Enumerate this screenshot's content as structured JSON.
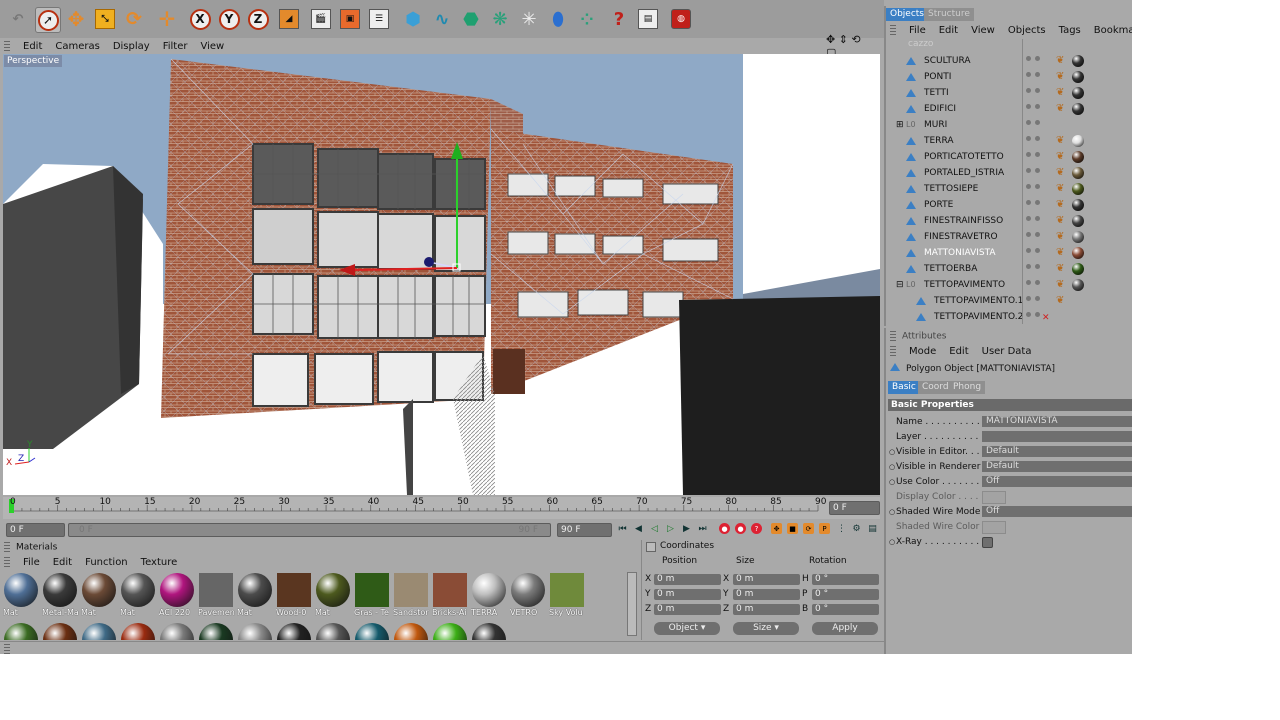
{
  "viewport": {
    "menu": [
      "Edit",
      "Cameras",
      "Display",
      "Filter",
      "View"
    ],
    "camera_label": "Perspective",
    "axis_labels": {
      "x": "X",
      "y": "Y",
      "z": "Z"
    }
  },
  "timeline": {
    "ticks": [
      "0",
      "5",
      "10",
      "15",
      "20",
      "25",
      "30",
      "35",
      "40",
      "45",
      "50",
      "55",
      "60",
      "65",
      "70",
      "75",
      "80",
      "85",
      "90"
    ],
    "current_frame": "0 F",
    "start_field": "0 F",
    "range_start": "0 F",
    "range_end": "90 F",
    "end_field": "90 F"
  },
  "materials": {
    "title": "Materials",
    "menu": [
      "File",
      "Edit",
      "Function",
      "Texture"
    ],
    "items": [
      {
        "label": "Mat",
        "color": "#4f6f96"
      },
      {
        "label": "Metal-Ma",
        "color": "#3a3a3a"
      },
      {
        "label": "Mat",
        "color": "#6b4a36"
      },
      {
        "label": "Mat",
        "color": "#555"
      },
      {
        "label": "ACI 220",
        "color": "#b0157e"
      },
      {
        "label": "Pavemen",
        "color": "#666"
      },
      {
        "label": "Mat",
        "color": "#4c4c4c"
      },
      {
        "label": "Wood-0",
        "color": "#5a3620"
      },
      {
        "label": "Mat",
        "color": "#4d5a1e"
      },
      {
        "label": "Gras - Te",
        "color": "#2f5b17"
      },
      {
        "label": "Sandstor",
        "color": "#9a8a72"
      },
      {
        "label": "Bricks-Ai",
        "color": "#8a4c36"
      },
      {
        "label": "TERRA",
        "color": "#bfbfbf"
      },
      {
        "label": "VETRO",
        "color": "#7b7b7b"
      },
      {
        "label": "Sky Volu",
        "color": "#6f8a3b"
      }
    ],
    "second_row_colors": [
      "#3a6b22",
      "#6b2f12",
      "#3f6a86",
      "#9a2b10",
      "#7a7a7a",
      "#1a3a22",
      "#8a8a8a",
      "#222",
      "#555",
      "#145a6b",
      "#c0580e",
      "#3cae16",
      "#333"
    ]
  },
  "coordinates": {
    "title": "Coordinates",
    "headers": [
      "Position",
      "Size",
      "Rotation"
    ],
    "rows": [
      {
        "axis": "X",
        "pos": "0 m",
        "size_axis": "X",
        "size": "0 m",
        "rot_axis": "H",
        "rot": "0 °"
      },
      {
        "axis": "Y",
        "pos": "0 m",
        "size_axis": "Y",
        "size": "0 m",
        "rot_axis": "P",
        "rot": "0 °"
      },
      {
        "axis": "Z",
        "pos": "0 m",
        "size_axis": "Z",
        "size": "0 m",
        "rot_axis": "B",
        "rot": "0 °"
      }
    ],
    "mode_select": "Object",
    "size_select": "Size",
    "apply_label": "Apply"
  },
  "objects": {
    "tabs": [
      "Objects",
      "Structure"
    ],
    "menu": [
      "File",
      "Edit",
      "View",
      "Objects",
      "Tags",
      "Bookmarks"
    ],
    "root": "cazzo",
    "items": [
      {
        "name": "SCULTURA",
        "tags": [
          "#333"
        ]
      },
      {
        "name": "PONTI",
        "tags": [
          "#333"
        ]
      },
      {
        "name": "TETTI",
        "tags": [
          "#333"
        ]
      },
      {
        "name": "EDIFICI",
        "tags": [
          "#333"
        ]
      },
      {
        "name": "MURI",
        "tags": [],
        "group": true
      },
      {
        "name": "TERRA",
        "tags": [
          "#ddd"
        ]
      },
      {
        "name": "PORTICATOTETTO",
        "tags": [
          "#5a3a28"
        ]
      },
      {
        "name": "PORTALED_ISTRIA",
        "tags": [
          "#6a5a3a"
        ]
      },
      {
        "name": "TETTOSIEPE",
        "tags": [
          "#4d5a1e"
        ]
      },
      {
        "name": "PORTE",
        "tags": [
          "#333"
        ]
      },
      {
        "name": "FINESTRAINFISSO",
        "tags": [
          "#444"
        ]
      },
      {
        "name": "FINESTRAVETRO",
        "tags": [
          "#777"
        ]
      },
      {
        "name": "MATTONIAVISTA",
        "tags": [
          "#8a4c36"
        ],
        "selected": true
      },
      {
        "name": "TETTOERBA",
        "tags": [
          "#2f5b17"
        ]
      },
      {
        "name": "TETTOPAVIMENTO",
        "tags": [
          "#555"
        ],
        "group": true,
        "expanded": true
      },
      {
        "name": "TETTOPAVIMENTO.1",
        "tags": [],
        "child": true
      },
      {
        "name": "TETTOPAVIMENTO.2",
        "tags": [],
        "child": true,
        "x": true
      }
    ]
  },
  "attributes": {
    "title": "Attributes",
    "menu": [
      "Mode",
      "Edit",
      "User Data"
    ],
    "object_title": "Polygon Object [MATTONIAVISTA]",
    "tabs": [
      "Basic",
      "Coord",
      "Phong"
    ],
    "section": "Basic Properties",
    "rows": [
      {
        "key": "Name . . . . . . . . . . . .",
        "value": "MATTONIAVISTA"
      },
      {
        "key": "Layer . . . . . . . . . . . .",
        "value": ""
      },
      {
        "key": "Visible in Editor. . . . .",
        "value": "Default",
        "dot": true
      },
      {
        "key": "Visible in Renderer . .",
        "value": "Default",
        "dot": true
      },
      {
        "key": "Use Color . . . . . . . . .",
        "value": "Off",
        "dot": true
      },
      {
        "key": "Display Color . . . .",
        "value": "",
        "disabled": true
      },
      {
        "key": "Shaded Wire Mode",
        "value": "Off",
        "dot": true
      },
      {
        "key": "Shaded Wire Color",
        "value": "",
        "disabled": true
      },
      {
        "key": "X-Ray . . . . . . . . . . . .",
        "value": "",
        "dot": true,
        "checkbox": true
      }
    ]
  },
  "colors": {
    "selection": "#3b7fc4",
    "panel": "#a9a9a9",
    "field": "#6f6f6f",
    "sky": "#8fa9c6",
    "brick": "#a0553a"
  }
}
